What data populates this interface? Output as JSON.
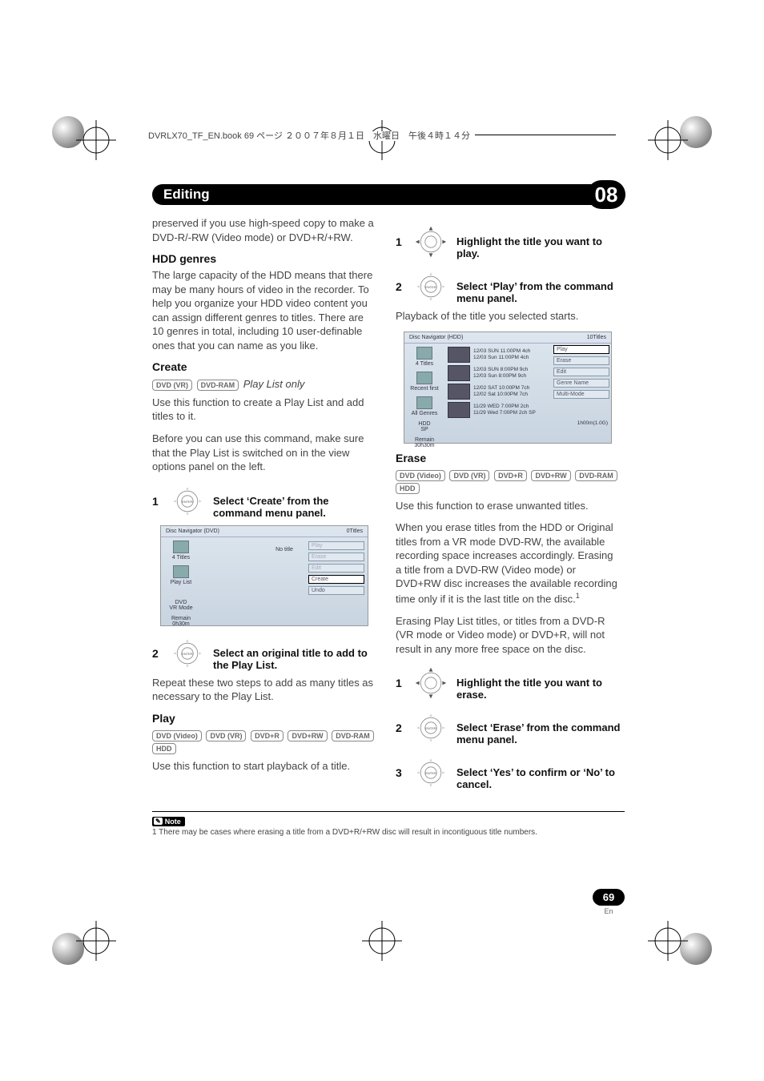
{
  "print_header": "DVRLX70_TF_EN.book  69 ページ  ２００７年８月１日　水曜日　午後４時１４分",
  "chapter": {
    "title": "Editing",
    "number": "08"
  },
  "page": {
    "number": "69",
    "lang": "En"
  },
  "left": {
    "para_preserved": "preserved if you use high-speed copy to make a DVD-R/-RW (Video mode) or DVD+R/+RW.",
    "hdd_genres": {
      "heading": "HDD genres",
      "body": "The large capacity of the HDD means that there may be many hours of video in the recorder. To help you organize your HDD video content you can assign different genres to titles. There are 10 genres in total, including 10 user-definable ones that you can name as you like."
    },
    "create": {
      "heading": "Create",
      "chips": [
        "DVD (VR)",
        "DVD-RAM"
      ],
      "chips_note": "Play List only",
      "body1": "Use this function to create a Play List and add titles to it.",
      "body2": "Before you can use this command, make sure that the Play List is switched on in the view options panel on the left.",
      "step1_num": "1",
      "step1": "Select ‘Create’ from the command menu panel.",
      "step2_num": "2",
      "step2": "Select an original title to add to the Play List.",
      "step2_body": "Repeat these two steps to add as many titles as necessary to the Play List."
    },
    "shot1": {
      "title": "Disc Navigator (DVD)",
      "right_label": "0Titles",
      "side": [
        {
          "label": "4 Titles"
        },
        {
          "label": "Play List"
        },
        {
          "label": "DVD\nVR Mode"
        },
        {
          "label": "Remain\n0h30m"
        }
      ],
      "main_text": "No title",
      "menu": [
        "Play",
        "Erase",
        "Edit",
        "Create",
        "Undo"
      ],
      "menu_active": "Create",
      "menu_dim": [
        "Play",
        "Erase",
        "Edit"
      ]
    },
    "play": {
      "heading": "Play",
      "chips": [
        "DVD (Video)",
        "DVD (VR)",
        "DVD+R",
        "DVD+RW",
        "DVD-RAM",
        "HDD"
      ],
      "body": "Use this function to start playback of a title."
    }
  },
  "right": {
    "step1_num": "1",
    "step1": "Highlight the title you want to play.",
    "step2_num": "2",
    "step2": "Select ‘Play’ from the command menu panel.",
    "step2_body": "Playback of the title you selected starts.",
    "shot2": {
      "title": "Disc Navigator (HDD)",
      "right_label": "10Titles",
      "side": [
        {
          "label": "4 Titles"
        },
        {
          "label": "Recent first"
        },
        {
          "label": "All Genres"
        },
        {
          "label": "HDD\nSP"
        },
        {
          "label": "Remain\n30h30m"
        }
      ],
      "rows": [
        "12/03 SUN 11:00PM 4ch",
        "12/03 Sun 11:00PM 4ch",
        "12/03 SUN  8:00PM 9ch",
        "12/03  Sun  8:00PM 9ch",
        "12/02 SAT 10:00PM 7ch",
        "12/02 Sat 10:00PM 7ch",
        "11/29 WED 7:00PM 2ch",
        "11/29 Wed 7:00PM 2ch  SP"
      ],
      "duration": "1h00m(1.0G)",
      "menu": [
        "Play",
        "Erase",
        "Edit",
        "Genre Name",
        "Multi-Mode"
      ],
      "menu_active": "Play"
    },
    "erase": {
      "heading": "Erase",
      "chips": [
        "DVD (Video)",
        "DVD (VR)",
        "DVD+R",
        "DVD+RW",
        "DVD-RAM",
        "HDD"
      ],
      "body1": "Use this function to erase unwanted titles.",
      "body2_a": "When you erase titles from the HDD or Original titles from a VR mode DVD-RW, the available recording space increases accordingly. Erasing a title from a DVD-RW (Video mode) or DVD+RW disc increases the available recording time only if it is the last title on the disc.",
      "body2_sup": "1",
      "body3": "Erasing Play List titles, or titles from a DVD-R (VR mode or Video mode) or DVD+R, will not result in any more free space on the disc.",
      "step1_num": "1",
      "step1": "Highlight the title you want to erase.",
      "step2_num": "2",
      "step2": "Select ‘Erase’ from the command menu panel.",
      "step3_num": "3",
      "step3": "Select ‘Yes’ to confirm or ‘No’ to cancel."
    }
  },
  "note": {
    "label": "Note",
    "text": "1 There may be cases where erasing a title from a DVD+R/+RW disc will result in incontiguous title numbers."
  }
}
